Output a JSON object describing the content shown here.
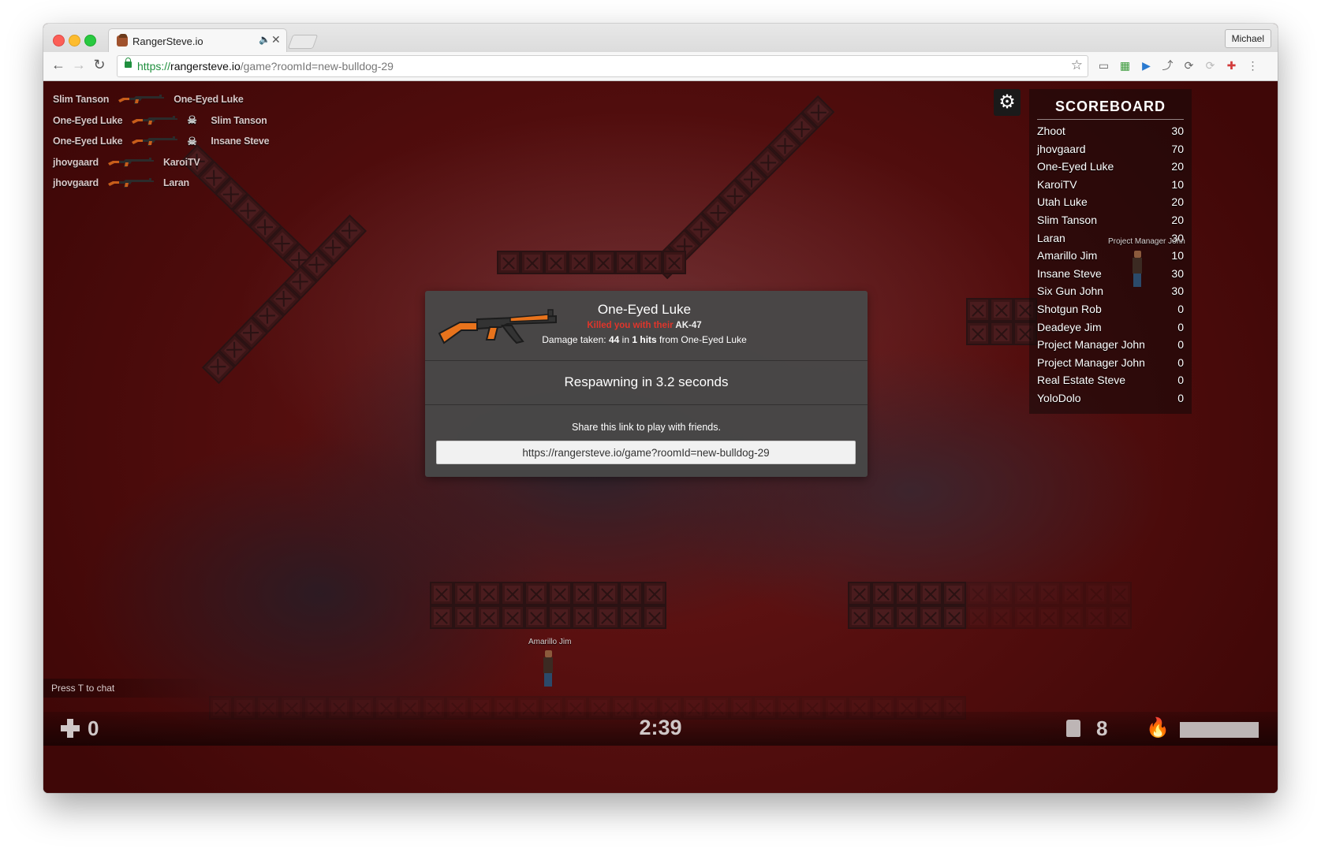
{
  "browser": {
    "tab_title": "RangerSteve.io",
    "profile_name": "Michael",
    "url_scheme": "https://",
    "url_host": "rangersteve.io",
    "url_path": "/game?roomId=new-bulldog-29"
  },
  "kill_feed": [
    {
      "killer": "Slim Tanson",
      "victim": "One-Eyed Luke",
      "headshot": false
    },
    {
      "killer": "One-Eyed Luke",
      "victim": "Slim Tanson",
      "headshot": true
    },
    {
      "killer": "One-Eyed Luke",
      "victim": "Insane Steve",
      "headshot": true
    },
    {
      "killer": "jhovgaard",
      "victim": "KaroiTV",
      "headshot": false
    },
    {
      "killer": "jhovgaard",
      "victim": "Laran",
      "headshot": false
    }
  ],
  "scoreboard": {
    "title": "SCOREBOARD",
    "rows": [
      {
        "name": "Zhoot",
        "score": "30"
      },
      {
        "name": "jhovgaard",
        "score": "70"
      },
      {
        "name": "One-Eyed Luke",
        "score": "20"
      },
      {
        "name": "KaroiTV",
        "score": "10"
      },
      {
        "name": "Utah Luke",
        "score": "20"
      },
      {
        "name": "Slim Tanson",
        "score": "20"
      },
      {
        "name": "Laran",
        "score": "30"
      },
      {
        "name": "Amarillo Jim",
        "score": "10"
      },
      {
        "name": "Insane Steve",
        "score": "30"
      },
      {
        "name": "Six Gun John",
        "score": "30"
      },
      {
        "name": "Shotgun Rob",
        "score": "0"
      },
      {
        "name": "Deadeye Jim",
        "score": "0"
      },
      {
        "name": "Project Manager John",
        "score": "0"
      },
      {
        "name": "Project Manager John",
        "score": "0"
      },
      {
        "name": "Real Estate Steve",
        "score": "0"
      },
      {
        "name": "YoloDolo",
        "score": "0"
      }
    ]
  },
  "players_on_map": {
    "amarillo": "Amarillo Jim",
    "project_manager": "Project Manager John"
  },
  "death_modal": {
    "killer_name": "One-Eyed Luke",
    "killed_prefix": "Killed you with their",
    "weapon": "AK-47",
    "damage_label": "Damage taken:",
    "damage_amount": "44",
    "damage_in": "in",
    "hits": "1 hits",
    "damage_from": "from One-Eyed Luke",
    "respawn_text": "Respawning in 3.2 seconds",
    "share_text": "Share this link to play with friends.",
    "share_link": "https://rangersteve.io/game?roomId=new-bulldog-29"
  },
  "hud": {
    "chat_hint": "Press T to chat",
    "health": "0",
    "timer": "2:39",
    "ammo": "8",
    "fuel_fraction": 1.0
  },
  "colors": {
    "kill_red": "#e0352b",
    "gun_orange": "#e8731c",
    "scheme_green": "#1f8f3e"
  },
  "icons": {
    "settings": "gear-icon",
    "health": "plus-icon",
    "ammo": "ammo-box-icon",
    "fuel": "flame-icon",
    "headshot": "skull-icon"
  }
}
